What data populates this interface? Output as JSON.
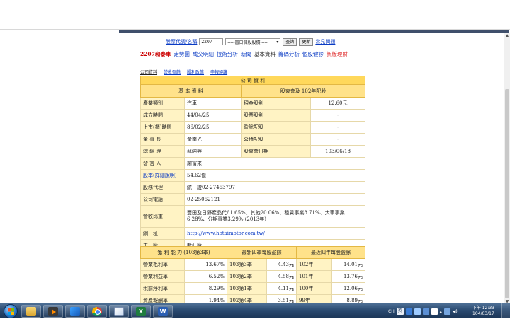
{
  "search": {
    "label": "股票代號/名稱",
    "value": "2207",
    "select_value": "-----當日個股股價-----",
    "query_button": "查詢",
    "update_button": "更新",
    "faq_link": "常見問題"
  },
  "nav": {
    "items": [
      {
        "label": "2207和泰車",
        "style": "n-red"
      },
      {
        "label": "走勢圖",
        "style": "n-blue"
      },
      {
        "label": "成交明細",
        "style": "n-blue"
      },
      {
        "label": "技術分析",
        "style": "n-blue"
      },
      {
        "label": "新聞",
        "style": "n-blue"
      },
      {
        "label": "基本資料",
        "style": "n-black"
      },
      {
        "label": "籌碼分析",
        "style": "n-blue"
      },
      {
        "label": "個股健診",
        "style": "n-blue"
      },
      {
        "label": "新版理財",
        "style": "n-lred"
      }
    ]
  },
  "sub_tabs": [
    {
      "label": "公司資料",
      "active": true
    },
    {
      "label": "營收盈餘",
      "active": false
    },
    {
      "label": "股利政策",
      "active": false
    },
    {
      "label": "申報轉讓",
      "active": false
    }
  ],
  "info": {
    "title": "公 司 資 料",
    "basic_header": "基 本 資 料",
    "dividend_header": "股東會及 102年配股",
    "rows": [
      {
        "label": "產業類別",
        "value": "汽車",
        "d_label": "現金股利",
        "d_value": "12.60元"
      },
      {
        "label": "成立時間",
        "value": "44/04/25",
        "d_label": "股票股利",
        "d_value": "-"
      },
      {
        "label": "上市(櫃)時間",
        "value": "86/02/25",
        "d_label": "盈餘配股",
        "d_value": "-"
      },
      {
        "label": "董 事 長",
        "value": "黃南光",
        "d_label": "公積配股",
        "d_value": "-"
      },
      {
        "label": "總 經 理",
        "value": "蘇純興",
        "d_label": "股東會日期",
        "d_value": "103/06/18"
      }
    ],
    "spokesman_label": "發 言 人",
    "spokesman_value": "謝富來",
    "capital_label": "股本(詳細說明)",
    "capital_value": "54.62億",
    "agent_label": "股務代理",
    "agent_value": "統一證02-27463797",
    "phone_label": "公司電話",
    "phone_value": "02-25062121",
    "revenue_label": "營收比重",
    "revenue_value": "豐田及日野產品代61.65%、其他20.06%、租賃事業8.71%、大車事業6.28%、分期事業3.29% (2013年)",
    "url_label": "網　址",
    "url_value": "http://www.hotaimotor.com.tw/",
    "factory_label": "工　廠",
    "factory_value": "新莊廠"
  },
  "earnings": {
    "header_profit": "獲 利 能 力 (103第3季)",
    "header_recent": "最新四季每股盈餘",
    "header_years": "最近四年每股盈餘",
    "rows": [
      {
        "label": "營業毛利率",
        "value": "13.67%",
        "q": "103第3季",
        "q_eps": "4.43元",
        "y": "102年",
        "y_eps": "14.01元"
      },
      {
        "label": "營業利益率",
        "value": "6.52%",
        "q": "103第2季",
        "q_eps": "4.58元",
        "y": "101年",
        "y_eps": "13.76元"
      },
      {
        "label": "稅前淨利率",
        "value": "8.29%",
        "q": "103第1季",
        "q_eps": "4.11元",
        "y": "100年",
        "y_eps": "12.06元"
      },
      {
        "label": "資產報酬率",
        "value": "1.94%",
        "q": "102第4季",
        "q_eps": "3.51元",
        "y": "99年",
        "y_eps": "8.89元"
      }
    ]
  },
  "taskbar": {
    "ime_label": "CH",
    "time": "下午 12:33",
    "date": "104/03/17"
  }
}
